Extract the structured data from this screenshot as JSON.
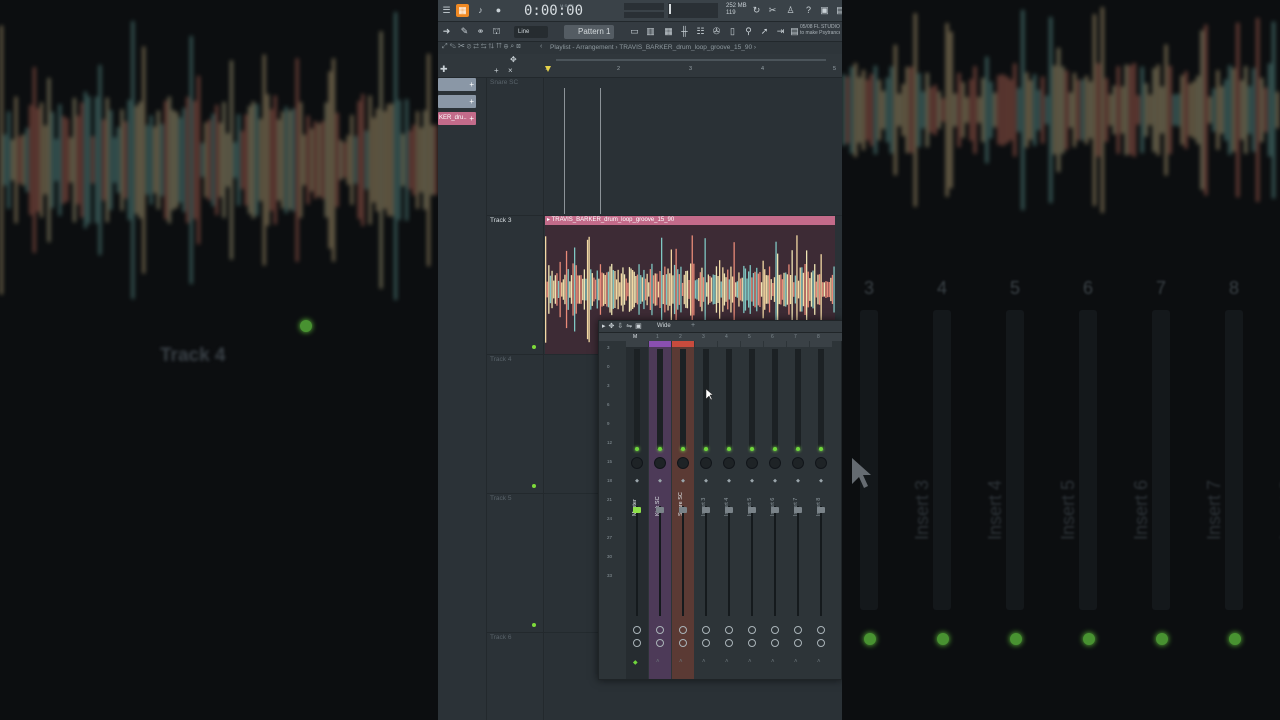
{
  "transport": {
    "time": "0:00:00",
    "time_unit": "M:S:CS",
    "memory": "252 MB",
    "cpu": "119"
  },
  "toolbar": {
    "snap": "Line",
    "pattern": "Pattern 1",
    "hint_line1": "05/08  FL STUDIO",
    "hint_line2": "to make Psytrance"
  },
  "breadcrumb": "Playlist - Arrangement › TRAVIS_BARKER_drum_loop_groove_15_90 ›",
  "picker": {
    "clips": [
      {
        "label": "",
        "color": "#8a97a6"
      },
      {
        "label": "",
        "color": "#8a97a6"
      },
      {
        "label": "KER_dru..",
        "color": "#c36b8a"
      }
    ]
  },
  "ruler": [
    "1",
    "2",
    "3",
    "4",
    "5"
  ],
  "tracks": [
    {
      "label": "Snare SC",
      "faded": true
    },
    {
      "label": "Track 3",
      "faded": false
    },
    {
      "label": "Track 4",
      "faded": true
    },
    {
      "label": "Track 5",
      "faded": true
    },
    {
      "label": "Track 6",
      "faded": true
    }
  ],
  "clip": {
    "name": "TRAVIS_BARKER_drum_loop_groove_15_90",
    "color": "#c36b8a"
  },
  "mixer": {
    "preset": "Wide",
    "channel_numbers": [
      "M",
      "1",
      "2",
      "3",
      "4",
      "5",
      "6",
      "7",
      "8"
    ],
    "meter_scale": [
      "3",
      "0",
      "3",
      "6",
      "9",
      "12",
      "15",
      "18",
      "21",
      "24",
      "27",
      "30",
      "33"
    ],
    "strips": [
      {
        "name": "Master",
        "kind": "master"
      },
      {
        "name": "Kick SC",
        "kind": "kick"
      },
      {
        "name": "Snare SC",
        "kind": "snare"
      },
      {
        "name": "Insert 3",
        "kind": "insert"
      },
      {
        "name": "Insert 4",
        "kind": "insert"
      },
      {
        "name": "Insert 5",
        "kind": "insert"
      },
      {
        "name": "Insert 6",
        "kind": "insert"
      },
      {
        "name": "Insert 7",
        "kind": "insert"
      },
      {
        "name": "Insert 8",
        "kind": "insert"
      }
    ]
  },
  "background": {
    "track_label": "Track 4",
    "numbers": [
      "3",
      "4",
      "5",
      "6",
      "7",
      "8"
    ],
    "inserts": [
      "Insert 3",
      "Insert 4",
      "Insert 5",
      "Insert 6",
      "Insert 7",
      "Insert 8"
    ]
  },
  "colors": {
    "accent": "#f08a24",
    "led": "#6fd63c",
    "clip": "#c36b8a",
    "kick_strip": "#4d3a58",
    "snare_strip": "#5b3a34"
  }
}
